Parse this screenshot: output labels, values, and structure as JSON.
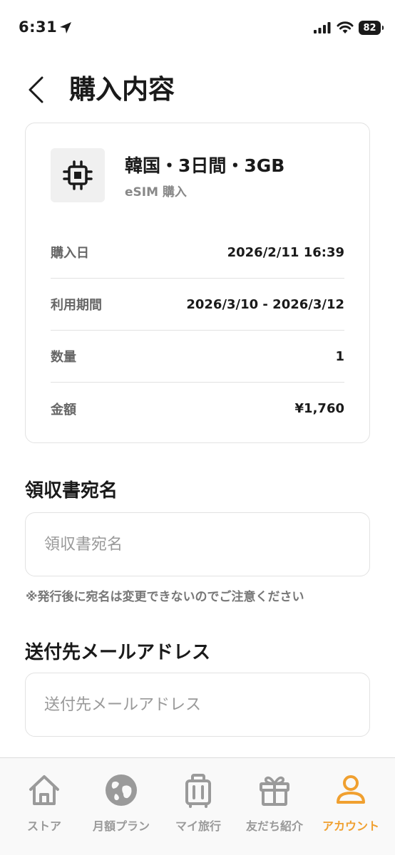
{
  "status_bar": {
    "time": "6:31",
    "battery": "82"
  },
  "header": {
    "title": "購入内容"
  },
  "product": {
    "icon": "chip-icon",
    "title": "韓国・3日間・3GB",
    "subtitle": "eSIM 購入"
  },
  "details": [
    {
      "label": "購入日",
      "value": "2026/2/11 16:39"
    },
    {
      "label": "利用期間",
      "value": "2026/3/10 - 2026/3/12"
    },
    {
      "label": "数量",
      "value": "1"
    },
    {
      "label": "金額",
      "value": "¥1,760"
    }
  ],
  "receipt": {
    "label": "領収書宛名",
    "placeholder": "領収書宛名",
    "value": "",
    "note": "※発行後に宛名は変更できないのでご注意ください"
  },
  "email": {
    "label": "送付先メールアドレス",
    "placeholder": "送付先メールアドレス",
    "value": ""
  },
  "tabbar": {
    "active_color": "#f0a030",
    "inactive_color": "#9a9a9a",
    "items": [
      {
        "label": "ストア",
        "icon": "home-icon"
      },
      {
        "label": "月額プラン",
        "icon": "globe-icon"
      },
      {
        "label": "マイ旅行",
        "icon": "suitcase-icon"
      },
      {
        "label": "友だち紹介",
        "icon": "gift-icon"
      },
      {
        "label": "アカウント",
        "icon": "person-icon",
        "active": true
      }
    ]
  }
}
